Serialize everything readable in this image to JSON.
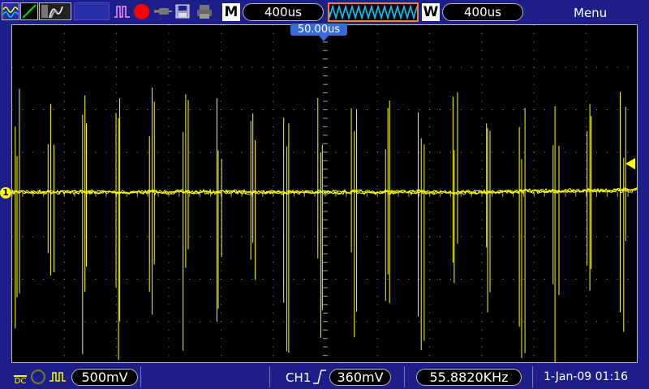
{
  "top": {
    "run_mode_badge": "M",
    "timebase_value": "400us",
    "window_badge": "W",
    "window_value": "400us",
    "menu_label": "Menu",
    "trigger_position": "50.00us"
  },
  "bottom": {
    "coupling": "DC",
    "ch1_scale": "500mV",
    "trigger_source": "CH1",
    "trigger_level": "360mV",
    "frequency": "55.8820KHz",
    "datetime": "1-Jan-09 01:16"
  },
  "markers": {
    "channel_label": "1"
  },
  "colors": {
    "trace": "#ffff00",
    "background": "#1c1f8a",
    "screen": "#000000",
    "record": "#ff0000",
    "timebase_border": "#ff7f27"
  }
}
